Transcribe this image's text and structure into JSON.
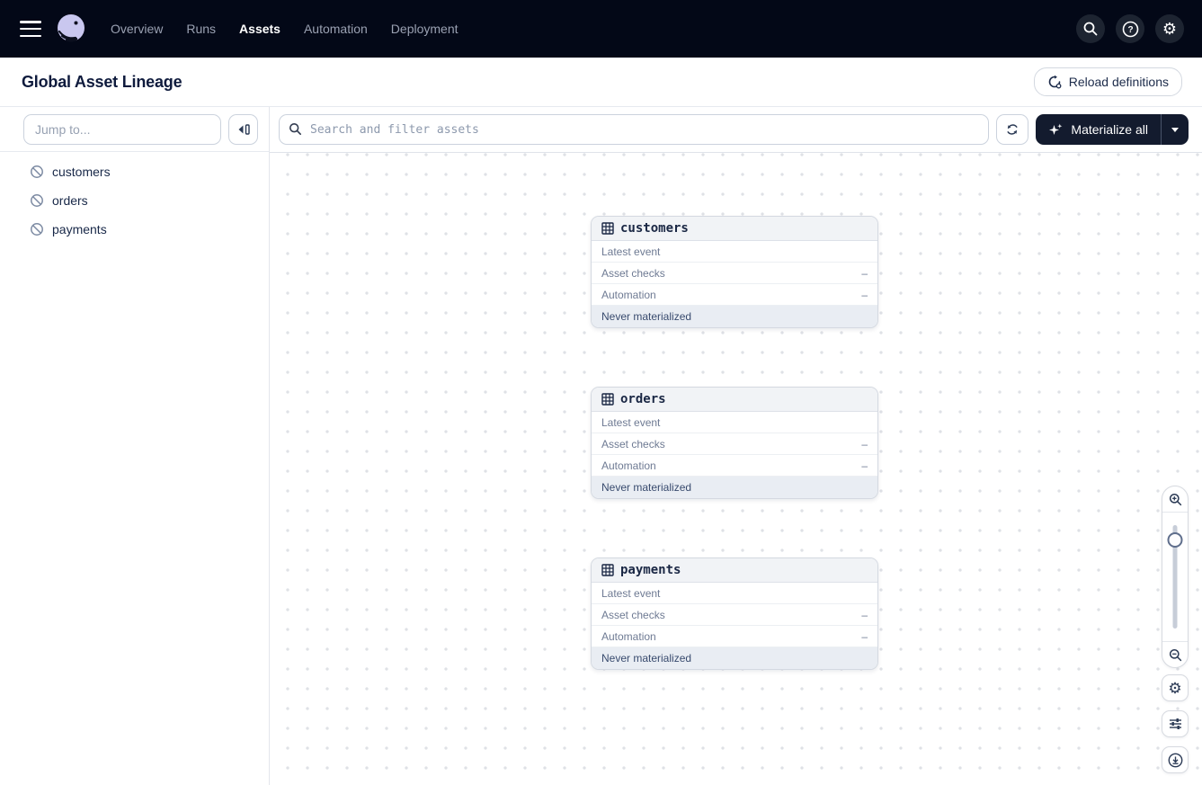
{
  "nav": {
    "items": [
      {
        "label": "Overview"
      },
      {
        "label": "Runs"
      },
      {
        "label": "Assets"
      },
      {
        "label": "Automation"
      },
      {
        "label": "Deployment"
      }
    ],
    "active": "Assets",
    "right_icons": [
      "search-icon",
      "help-icon",
      "gear-icon"
    ]
  },
  "header": {
    "title": "Global Asset Lineage",
    "reload_label": "Reload definitions"
  },
  "sidebar": {
    "jump_placeholder": "Jump to...",
    "items": [
      {
        "icon": "slashed-circle-icon",
        "label": "customers"
      },
      {
        "icon": "slashed-circle-icon",
        "label": "orders"
      },
      {
        "icon": "slashed-circle-icon",
        "label": "payments"
      }
    ]
  },
  "toolbar": {
    "search_placeholder": "Search and filter assets",
    "refresh_icon": "refresh-icon",
    "materialize_label": "Materialize all",
    "materialize_icon": "sparkle-icon"
  },
  "canvas": {
    "nodes": [
      {
        "title": "customers",
        "icon": "table-icon",
        "rows": [
          {
            "label": "Latest event",
            "value": ""
          },
          {
            "label": "Asset checks",
            "value": "–"
          },
          {
            "label": "Automation",
            "value": "–"
          }
        ],
        "footer": "Never materialized"
      },
      {
        "title": "orders",
        "icon": "table-icon",
        "rows": [
          {
            "label": "Latest event",
            "value": ""
          },
          {
            "label": "Asset checks",
            "value": "–"
          },
          {
            "label": "Automation",
            "value": "–"
          }
        ],
        "footer": "Never materialized"
      },
      {
        "title": "payments",
        "icon": "table-icon",
        "rows": [
          {
            "label": "Latest event",
            "value": ""
          },
          {
            "label": "Asset checks",
            "value": "–"
          },
          {
            "label": "Automation",
            "value": "–"
          }
        ],
        "footer": "Never materialized"
      }
    ],
    "controls": [
      "zoom-in-icon",
      "zoom-slider",
      "zoom-out-icon",
      "gear-icon",
      "tune-icon",
      "download-view-icon"
    ]
  },
  "colors": {
    "nav_bg": "#030817",
    "logo_lavender": "#c9c7ef",
    "materialize_bg": "#131b2e",
    "node_header_bg": "#f1f3f6",
    "node_footer_bg": "#e9edf3",
    "dot_grid": "#dfe1e6"
  }
}
